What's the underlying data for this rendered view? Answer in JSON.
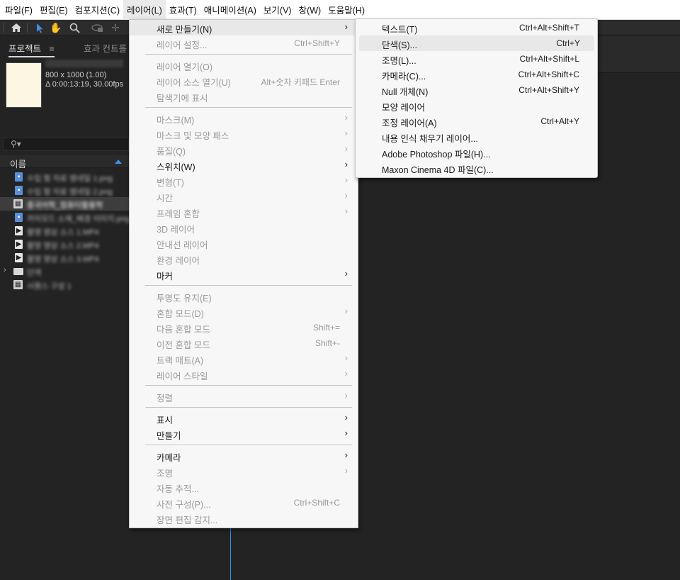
{
  "menubar": {
    "items": [
      "파일(F)",
      "편집(E)",
      "컴포지션(C)",
      "레이어(L)",
      "효과(T)",
      "애니메이션(A)",
      "보기(V)",
      "창(W)",
      "도움말(H)"
    ]
  },
  "toolbar": {
    "icons": [
      "home-icon",
      "selection-arrow-icon",
      "hand-icon",
      "zoom-icon",
      "orbit-camera-icon",
      "pan-behind-icon"
    ]
  },
  "project_panel": {
    "tab_project": "프로젝트",
    "tab_menu_glyph": "≡",
    "tab_effects": "효과 컨트롤",
    "thumb_dimensions": "800 x 1000 (1.00)",
    "thumb_duration": "Δ 0:00:13:19, 30.00fps",
    "search_icon": "⚲▾",
    "column_name": "이름",
    "files": [
      {
        "type": "img",
        "name": "수입 형 자료 썸네일 1.png"
      },
      {
        "type": "img",
        "name": "수입 형 자료 썸네일 2.png"
      },
      {
        "type": "comp",
        "name": "중국어학_컴퓨터활용학",
        "selected": true
      },
      {
        "type": "img",
        "name": "카이모드 소재_배경 이미지.png"
      },
      {
        "type": "video",
        "name": "촬영 영상 소스 1.MP4"
      },
      {
        "type": "video",
        "name": "촬영 영상 소스 2.MP4"
      },
      {
        "type": "video",
        "name": "촬영 영상 소스 3.MP4"
      },
      {
        "type": "folder",
        "name": "단색"
      },
      {
        "type": "comp",
        "name": "시퀀스 구성 1"
      }
    ]
  },
  "layer_menu": {
    "items": [
      {
        "label": "새로 만들기(N)",
        "shortcut": "",
        "arrow": true,
        "disabled": false,
        "highlight": true
      },
      {
        "label": "레이어 설정...",
        "shortcut": "Ctrl+Shift+Y",
        "arrow": false,
        "disabled": true
      },
      {
        "sep": true
      },
      {
        "label": "레이어 열기(O)",
        "shortcut": "",
        "arrow": false,
        "disabled": true
      },
      {
        "label": "레이어 소스 열기(U)",
        "shortcut": "Alt+숫자 키패드 Enter",
        "arrow": false,
        "disabled": true
      },
      {
        "label": "탐색기에 표시",
        "shortcut": "",
        "arrow": false,
        "disabled": true
      },
      {
        "sep": true
      },
      {
        "label": "마스크(M)",
        "shortcut": "",
        "arrow": true,
        "disabled": true
      },
      {
        "label": "마스크 및 모양 패스",
        "shortcut": "",
        "arrow": true,
        "disabled": true
      },
      {
        "label": "품질(Q)",
        "shortcut": "",
        "arrow": true,
        "disabled": true
      },
      {
        "label": "스위치(W)",
        "shortcut": "",
        "arrow": true,
        "disabled": false
      },
      {
        "label": "변형(T)",
        "shortcut": "",
        "arrow": true,
        "disabled": true
      },
      {
        "label": "시간",
        "shortcut": "",
        "arrow": true,
        "disabled": true
      },
      {
        "label": "프레임 혼합",
        "shortcut": "",
        "arrow": true,
        "disabled": true
      },
      {
        "label": "3D 레이어",
        "shortcut": "",
        "arrow": false,
        "disabled": true
      },
      {
        "label": "안내선 레이어",
        "shortcut": "",
        "arrow": false,
        "disabled": true
      },
      {
        "label": "환경 레이어",
        "shortcut": "",
        "arrow": false,
        "disabled": true
      },
      {
        "label": "마커",
        "shortcut": "",
        "arrow": true,
        "disabled": false
      },
      {
        "sep": true
      },
      {
        "label": "투명도 유지(E)",
        "shortcut": "",
        "arrow": false,
        "disabled": true
      },
      {
        "label": "혼합 모드(D)",
        "shortcut": "",
        "arrow": true,
        "disabled": true
      },
      {
        "label": "다음 혼합 모드",
        "shortcut": "Shift+=",
        "arrow": false,
        "disabled": true
      },
      {
        "label": "이전 혼합 모드",
        "shortcut": "Shift+-",
        "arrow": false,
        "disabled": true
      },
      {
        "label": "트랙 매트(A)",
        "shortcut": "",
        "arrow": true,
        "disabled": true
      },
      {
        "label": "레이어 스타일",
        "shortcut": "",
        "arrow": true,
        "disabled": true
      },
      {
        "sep": true
      },
      {
        "label": "정렬",
        "shortcut": "",
        "arrow": true,
        "disabled": true
      },
      {
        "sep": true
      },
      {
        "label": "표시",
        "shortcut": "",
        "arrow": true,
        "disabled": false
      },
      {
        "label": "만들기",
        "shortcut": "",
        "arrow": true,
        "disabled": false
      },
      {
        "sep": true
      },
      {
        "label": "카메라",
        "shortcut": "",
        "arrow": true,
        "disabled": false
      },
      {
        "label": "조명",
        "shortcut": "",
        "arrow": true,
        "disabled": true
      },
      {
        "label": "자동 추적...",
        "shortcut": "",
        "arrow": false,
        "disabled": true
      },
      {
        "label": "사전 구성(P)...",
        "shortcut": "Ctrl+Shift+C",
        "arrow": false,
        "disabled": true
      },
      {
        "label": "장면 편집 감지...",
        "shortcut": "",
        "arrow": false,
        "disabled": true
      }
    ]
  },
  "new_submenu": {
    "items": [
      {
        "label": "텍스트(T)",
        "shortcut": "Ctrl+Alt+Shift+T"
      },
      {
        "label": "단색(S)...",
        "shortcut": "Ctrl+Y",
        "highlight": true
      },
      {
        "label": "조명(L)...",
        "shortcut": "Ctrl+Alt+Shift+L"
      },
      {
        "label": "카메라(C)...",
        "shortcut": "Ctrl+Alt+Shift+C"
      },
      {
        "label": "Null 개체(N)",
        "shortcut": "Ctrl+Alt+Shift+Y"
      },
      {
        "label": "모양 레이어",
        "shortcut": ""
      },
      {
        "label": "조정 레이어(A)",
        "shortcut": "Ctrl+Alt+Y"
      },
      {
        "label": "내용 인식 채우기 레이어...",
        "shortcut": ""
      },
      {
        "label": "Adobe Photoshop 파일(H)...",
        "shortcut": ""
      },
      {
        "label": "Maxon Cinema 4D 파일(C)...",
        "shortcut": ""
      }
    ]
  },
  "colors": {
    "accent": "#3b8fe8",
    "panel_bg": "#232323",
    "menu_bg": "#f7f7f7",
    "menu_highlight": "#e8e8e8"
  }
}
